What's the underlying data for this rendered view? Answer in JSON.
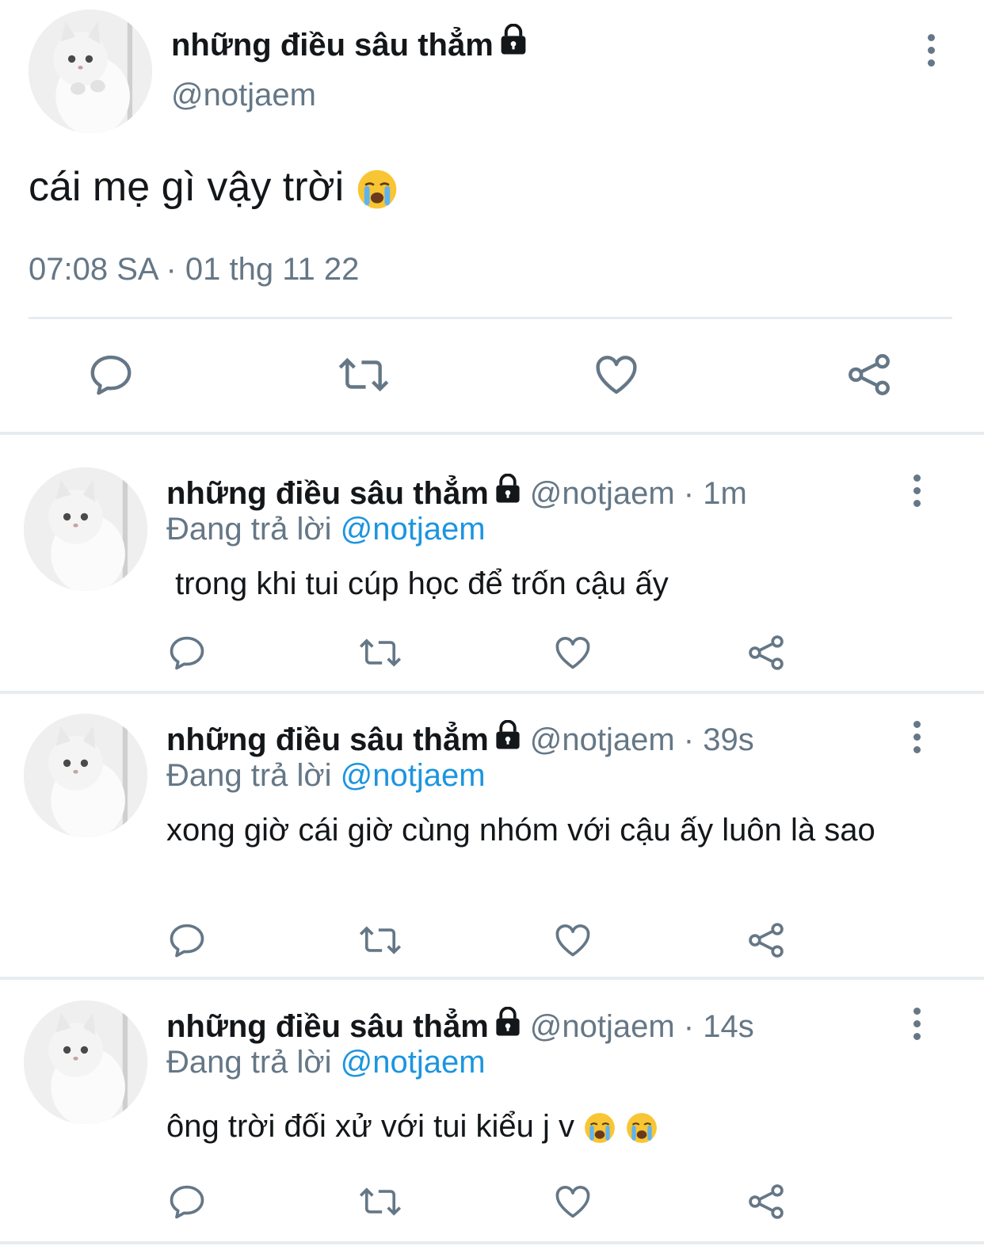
{
  "main_tweet": {
    "display_name": "những điều sâu thẳm",
    "handle": "@notjaem",
    "text": "cái mẹ gì vậy trời",
    "timestamp": "07:08 SA · 01 thg 11 22",
    "icons": [
      "comment-icon",
      "retweet-icon",
      "like-icon",
      "share-icon"
    ]
  },
  "replies": [
    {
      "display_name": "những điều sâu thẳm",
      "handle_time": "@notjaem · 1m",
      "replying_prefix": "Đang trả lời",
      "replying_to": "@notjaem",
      "text": " trong khi tui cúp học để trốn cậu ấy"
    },
    {
      "display_name": "những điều sâu thẳm",
      "handle_time": "@notjaem · 39s",
      "replying_prefix": "Đang trả lời",
      "replying_to": "@notjaem",
      "text": "xong giờ cái giờ cùng nhóm với cậu ấy luôn là sao"
    },
    {
      "display_name": "những điều sâu thẳm",
      "handle_time": "@notjaem · 14s",
      "replying_prefix": "Đang trả lời",
      "replying_to": "@notjaem",
      "text": "ông trời đối xử với tui kiểu j v"
    }
  ],
  "colors": {
    "text": "#14171a",
    "secondary": "#657786",
    "link": "#1b95e0",
    "divider": "#e6ecf0",
    "emoji": "#f8c534"
  }
}
